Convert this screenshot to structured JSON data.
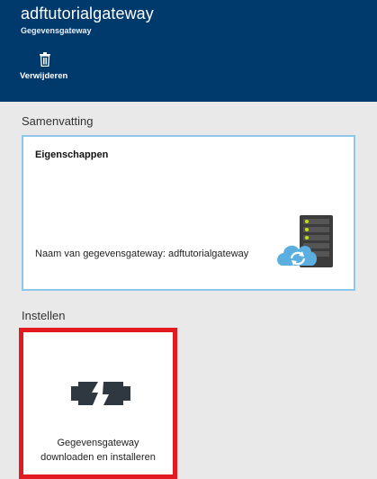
{
  "header": {
    "title": "adftutorialgateway",
    "subtitle": "Gegevensgateway",
    "delete_label": "Verwijderen",
    "background_color": "#003a6c"
  },
  "summary": {
    "section_label": "Samenvatting",
    "card_title": "Eigenschappen",
    "property_text": "Naam van gegevensgateway: adftutorialgateway",
    "art_icon": "gateway-cloud-server-icon"
  },
  "settings": {
    "section_label": "Instellen",
    "tile_line1": "Gegevensgateway",
    "tile_line2": "downloaden en installeren",
    "tile_icon": "plug-connector-icon",
    "highlight_color": "#e21b22"
  }
}
